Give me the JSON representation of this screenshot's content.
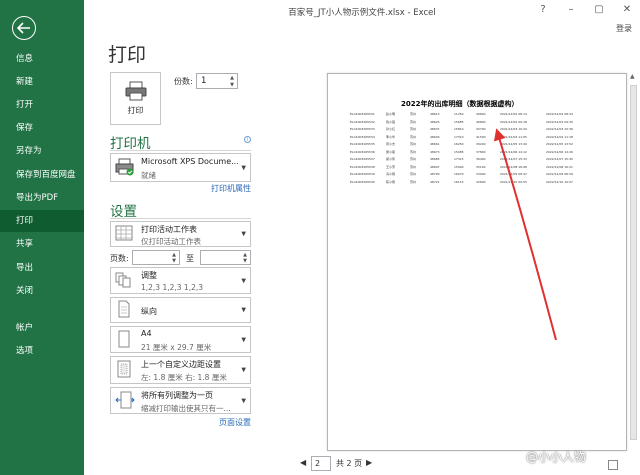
{
  "window": {
    "title": "百家号_JT小人物示例文件.xlsx - Excel",
    "controls": [
      "?",
      "–",
      "▢",
      "✕"
    ],
    "login": "登录"
  },
  "nav": {
    "items": [
      {
        "label": "信息",
        "active": false
      },
      {
        "label": "新建",
        "active": false
      },
      {
        "label": "打开",
        "active": false
      },
      {
        "label": "保存",
        "active": false
      },
      {
        "label": "另存为",
        "active": false
      },
      {
        "label": "保存到百度网盘",
        "active": false
      },
      {
        "label": "导出为PDF",
        "active": false
      },
      {
        "label": "打印",
        "active": true
      },
      {
        "label": "共享",
        "active": false
      },
      {
        "label": "导出",
        "active": false
      },
      {
        "label": "关闭",
        "active": false
      },
      {
        "label": "帐户",
        "active": false
      },
      {
        "label": "选项",
        "active": false
      }
    ]
  },
  "print": {
    "heading": "打印",
    "button_label": "打印",
    "copies_label": "份数:",
    "copies_value": "1"
  },
  "printer": {
    "section": "打印机",
    "name": "Microsoft XPS Docume...",
    "status": "就绪",
    "properties_link": "打印机属性"
  },
  "settings": {
    "section": "设置",
    "scope_title": "打印活动工作表",
    "scope_sub": "仅打印活动工作表",
    "pages_label": "页数:",
    "to_label": "至",
    "collate_title": "调整",
    "collate_sub": "1,2,3    1,2,3    1,2,3",
    "orientation_title": "纵向",
    "paper_title": "A4",
    "paper_sub": "21 厘米 x 29.7 厘米",
    "margin_title": "上一个自定义边距设置",
    "margin_sub": "左: 1.8 厘米    右: 1.8 厘米",
    "scaling_title": "将所有列调整为一页",
    "scaling_sub": "缩减打印输出使其只有一...",
    "page_setup_link": "页面设置"
  },
  "preview": {
    "sheet_title": "2022年的出库明细（数据根据虚构）",
    "rows": [
      [
        "ELC4003265531",
        "赵小明",
        "苏州",
        "48613",
        "11250",
        "49600",
        "2021/12/02 08:14",
        "2022/12/02 08:24"
      ],
      [
        "ELC4003265532",
        "钱小强",
        "苏州",
        "48625",
        "15685",
        "46800",
        "2021/12/02 09:18",
        "2022/12/02 09:30"
      ],
      [
        "ELC4003265533",
        "孙小红",
        "苏州",
        "48637",
        "15810",
        "43700",
        "2021/12/03 10:20",
        "2022/12/03 10:36"
      ],
      [
        "ELC4003265534",
        "李小华",
        "苏州",
        "48649",
        "17310",
        "41500",
        "2021/12/04 11:05",
        "2022/12/04 11:18"
      ],
      [
        "ELC4003265535",
        "周小杰",
        "苏州",
        "48661",
        "16250",
        "39200",
        "2021/12/05 13:40",
        "2022/12/05 13:52"
      ],
      [
        "ELC4003265536",
        "吴小丽",
        "苏州",
        "48673",
        "15985",
        "37800",
        "2021/12/06 14:12",
        "2022/12/06 14:26"
      ],
      [
        "ELC4003265537",
        "郑小伟",
        "苏州",
        "48685",
        "17315",
        "36400",
        "2021/12/07 15:33",
        "2022/12/07 15:45"
      ],
      [
        "ELC4003265538",
        "王小芳",
        "苏州",
        "48697",
        "15990",
        "35100",
        "2021/12/08 16:08",
        "2022/12/08 16:21"
      ],
      [
        "ELC4003265539",
        "冯小刚",
        "苏州",
        "48709",
        "16070",
        "33900",
        "2021/12/09 08:47",
        "2022/12/09 08:59"
      ],
      [
        "ELC4003265540",
        "陈小雨",
        "苏州",
        "48721",
        "16115",
        "32600",
        "2021/12/10 09:55",
        "2022/12/10 10:07"
      ]
    ],
    "page_current": "2",
    "page_total": "共 2 页",
    "prev_arrow": "◀",
    "next_arrow": "▶",
    "watermark": "@小小人物"
  },
  "colors": {
    "accent": "#217346",
    "nav_active": "#0e5c2f",
    "link": "#2b6bb7",
    "annotation_arrow": "#e03030"
  }
}
